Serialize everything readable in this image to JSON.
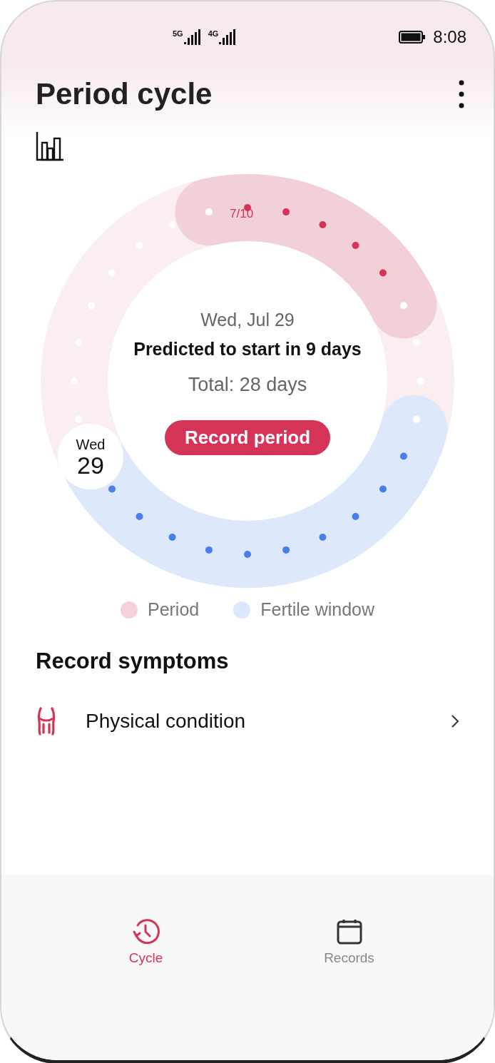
{
  "status_bar": {
    "networks": [
      "5G",
      "4G"
    ],
    "time": "8:08"
  },
  "header": {
    "title": "Period cycle"
  },
  "cycle": {
    "day_label": "7/10",
    "date": "Wed, Jul 29",
    "prediction": "Predicted to start in 9 days",
    "total": "Total: 28 days",
    "action": "Record period",
    "today_weekday": "Wed",
    "today_day": "29"
  },
  "legend": [
    {
      "label": "Period",
      "color": "#f3d3d9"
    },
    {
      "label": "Fertile window",
      "color": "#dce8fb"
    }
  ],
  "symptoms": {
    "title": "Record symptoms",
    "items": [
      {
        "label": "Physical condition"
      }
    ]
  },
  "tabs": [
    {
      "label": "Cycle",
      "selected": true,
      "kind": "clock"
    },
    {
      "label": "Records",
      "selected": false,
      "kind": "calendar"
    }
  ]
}
